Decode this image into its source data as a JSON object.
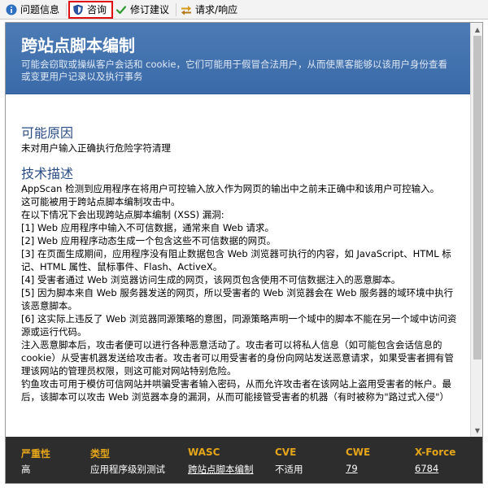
{
  "tabs": [
    {
      "label": "问题信息",
      "icon": "info-icon"
    },
    {
      "label": "咨询",
      "icon": "shield-icon",
      "active": true
    },
    {
      "label": "修订建议",
      "icon": "checkmark-icon"
    },
    {
      "label": "请求/响应",
      "icon": "exchange-icon"
    }
  ],
  "header": {
    "title": "跨站点脚本编制",
    "description": "可能会窃取或操纵客户会话和 cookie，它们可能用于假冒合法用户，从而使黑客能够以该用户身份查看或变更用户记录以及执行事务"
  },
  "sections": {
    "cause_heading": "可能原因",
    "cause_text": "未对用户输入正确执行危险字符清理",
    "tech_heading": "技术描述",
    "tech_paragraphs": [
      "AppScan 检测到应用程序在将用户可控输入放入作为网页的输出中之前未正确中和该用户可控输入。",
      "这可能被用于跨站点脚本编制攻击中。",
      "在以下情况下会出现跨站点脚本编制 (XSS) 漏洞:",
      "[1] Web 应用程序中输入不可信数据，通常来自 Web 请求。",
      "[2] Web 应用程序动态生成一个包含这些不可信数据的网页。",
      "[3] 在页面生成期间，应用程序没有阻止数据包含 Web 浏览器可执行的内容，如 JavaScript、HTML 标记、HTML 属性、鼠标事件、Flash、ActiveX。",
      "[4] 受害者通过 Web 浏览器访问生成的网页，该网页包含使用不可信数据注入的恶意脚本。",
      "[5] 因为脚本来自 Web 服务器发送的网页，所以受害者的 Web 浏览器会在 Web 服务器的域环境中执行该恶意脚本。",
      "[6] 这实际上违反了 Web 浏览器同源策略的意图，同源策略声明一个域中的脚本不能在另一个域中访问资源或运行代码。",
      "注入恶意脚本后，攻击者便可以进行各种恶意活动了。攻击者可以将私人信息（如可能包含会话信息的 cookie）从受害机器发送给攻击者。攻击者可以用受害者的身份向网站发送恶意请求，如果受害者拥有管理该网站的管理员权限，则这可能对网站特别危险。",
      "钓鱼攻击可用于模仿可信网站并哄骗受害者输入密码，从而允许攻击者在该网站上盗用受害者的帐户。最后，该脚本可以攻击 Web 浏览器本身的漏洞，从而可能接管受害者的机器（有时被称为\"路过式入侵\"）"
    ]
  },
  "footer": {
    "columns": [
      {
        "label": "严重性",
        "value": "高"
      },
      {
        "label": "类型",
        "value": "应用程序级别测试"
      },
      {
        "label": "WASC",
        "value": "跨站点脚本编制",
        "link": true
      },
      {
        "label": "CVE",
        "value": "不适用"
      },
      {
        "label": "CWE",
        "value": "79",
        "link": true
      },
      {
        "label": "X-Force",
        "value": "6784",
        "link": true
      }
    ]
  }
}
